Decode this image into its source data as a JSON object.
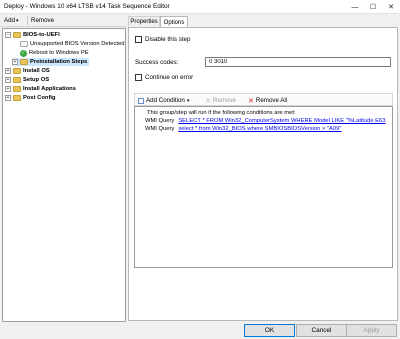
{
  "window": {
    "title": "Deploy - Windows 10 x64 LTSB v14 Task Sequence Editor",
    "minimize_glyph": "—",
    "maximize_glyph": "☐",
    "close_glyph": "✕"
  },
  "toolbar": {
    "add_label": "Add",
    "add_arrow": "▾",
    "remove_label": "Remove"
  },
  "tree": {
    "items": [
      {
        "label": "BIOS-to-UEFI",
        "expander": "−"
      },
      {
        "label": "Unsupported BIOS Version Detected"
      },
      {
        "label": "Reboot to Windows PE"
      },
      {
        "label": "Preinstallation Steps",
        "expander": "+"
      },
      {
        "label": "Install OS",
        "expander": "+"
      },
      {
        "label": "Setup OS",
        "expander": "+"
      },
      {
        "label": "Install Applications",
        "expander": "+"
      },
      {
        "label": "Post Config",
        "expander": "+"
      }
    ]
  },
  "tabs": [
    {
      "label": "Properties"
    },
    {
      "label": "Options"
    }
  ],
  "options": {
    "disable_step_label": "Disable this step",
    "disable_step_underline": "D",
    "success_codes_label": "Success codes:",
    "success_codes_underline": "S",
    "success_codes_value": "0 3010",
    "continue_on_error_label": "Continue on error",
    "continue_on_error_underline": "C"
  },
  "conditions": {
    "add_condition_label": "Add Condition",
    "add_condition_underline": "A",
    "add_arrow": "▾",
    "remove_label": "Remove",
    "remove_all_label": "Remove All",
    "header": "This group/step will run if the following conditions are met:",
    "rows": [
      {
        "type": "WMI Query",
        "query": "SELECT * FROM Win32_ComputerSystem WHERE Model LIKE \"%Latitude E63"
      },
      {
        "type": "WMI Query",
        "query": "select * from Win32_BIOS where SMBIOSBIOSVersion > \"A09\""
      }
    ]
  },
  "buttons": {
    "ok": "OK",
    "cancel": "Cancel",
    "apply": "Apply"
  },
  "colors": {
    "selection": "#cce8ff",
    "link": "#0000ee",
    "check_green": "#3aa640",
    "folder": "#e8c45a",
    "remove_red": "#d22",
    "primary_border": "#0078d7"
  }
}
